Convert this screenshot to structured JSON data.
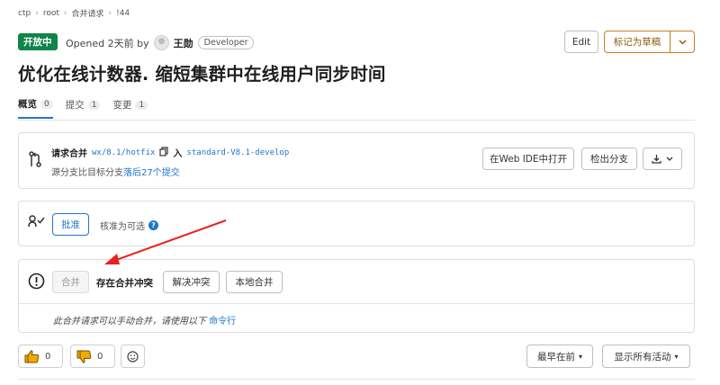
{
  "breadcrumb": [
    "ctp",
    "root",
    "合并请求",
    "!44"
  ],
  "header": {
    "status": "开放中",
    "opened_prefix": "Opened 2天前 by",
    "author": "王勋",
    "role": "Developer",
    "edit_label": "Edit",
    "draft_label": "标记为草稿"
  },
  "title": "优化在线计数器. 缩短集群中在线用户同步时间",
  "tabs": [
    {
      "label": "概览",
      "count": "0"
    },
    {
      "label": "提交",
      "count": "1"
    },
    {
      "label": "变更",
      "count": "1"
    }
  ],
  "merge_info": {
    "label": "请求合并",
    "source_branch": "wx/8.1/hotfix",
    "into": "入",
    "target_branch": "standard-V8.1-develop",
    "behind_prefix": "源分支比目标分支",
    "behind_link": "落后27个提交",
    "webide_label": "在Web IDE中打开",
    "checkout_label": "检出分支"
  },
  "approval": {
    "approve_label": "批准",
    "optional_text": "核准为可选"
  },
  "merge_widget": {
    "merge_label": "合并",
    "conflict_text": "存在合并冲突",
    "resolve_label": "解决冲突",
    "local_merge_label": "本地合并",
    "manual_text": "此合并请求可以手动合并，请使用以下",
    "manual_link": "命令行"
  },
  "reactions": {
    "thumbs_up": "0",
    "thumbs_down": "0"
  },
  "activity": {
    "sort_label": "最早在前",
    "filter_label": "显示所有活动"
  },
  "colors": {
    "open_badge": "#108548",
    "link": "#1f75cb",
    "draft_accent": "#c77d1a",
    "annotation_arrow": "#e8201e",
    "thumbs": "#f2a900"
  },
  "icons": {
    "merge_request": "merge-request-icon",
    "copy": "copy-icon",
    "download": "download-icon",
    "approval": "approval-icon",
    "help": "question-icon",
    "alert": "alert-circle-icon",
    "thumbs_up": "thumbs-up-icon",
    "thumbs_down": "thumbs-down-icon",
    "smile": "smile-icon"
  }
}
